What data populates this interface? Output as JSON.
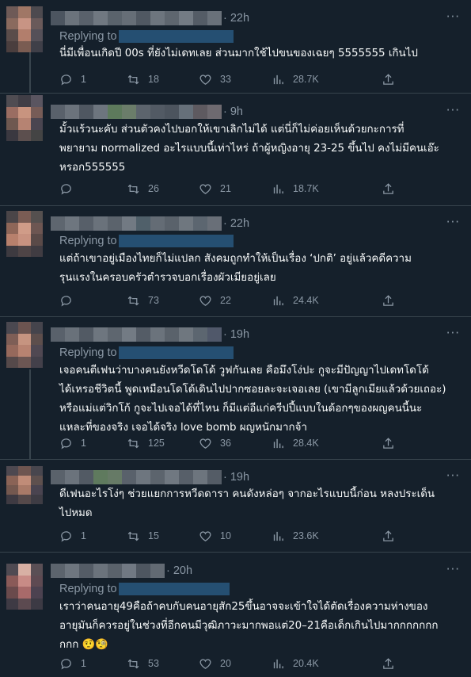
{
  "tweets": [
    {
      "time": "22h",
      "replying_to": "Replying to",
      "text": "นี่มีเพื่อนเกิดปี 00s ที่ยังไม่เดทเลย ส่วนมากใช้ไปขนของเฉยๆ 5555555 เกินไป",
      "replies": "1",
      "retweets": "18",
      "likes": "33",
      "views": "28.7K"
    },
    {
      "time": "9h",
      "replying_to": "",
      "text": "มั้วแร้วนะคับ ส่วนตัวคงไปบอกให้เขาเลิกไม่ได้ แต่นี่ก็ไม่ค่อยเห็นด้วยกะการที่\nพยายาม normalized อะไรแบบนี้เท่าไหร่ ถ้าผู้หญิงอายุ 23-25 ขึ้นไป คงไม่มีคนเอ๊ะ\nหรอก555555",
      "replies": "",
      "retweets": "26",
      "likes": "21",
      "views": "18.7K"
    },
    {
      "time": "22h",
      "replying_to": "Replying to",
      "text": "แต่ถ้าเขาอยู่เมืองไทยก็ไม่แปลก สังคมถูกทำให้เป็นเรื่อง ‘ปกติ’ อยู่แล้วคดีความ\nรุนแรงในครอบครัวตำรวจบอกเรื่องผัวเมียอยู่เลย",
      "replies": "",
      "retweets": "73",
      "likes": "22",
      "views": "24.4K"
    },
    {
      "time": "19h",
      "replying_to": "Replying to",
      "text": "เจอคนตีเฟนว่าบางคนยังหวีดโดโด้ วูฟกันเลย คือมึงโง่ปะ กูจะมีปัญญาไปเดทโดโด้\nได้เหรอชีวิตนี้ พูดเหมือนโดโด้เดินไปปากซอยละจะเจอเลย (เขามีลูกเมียแล้วด้วยเถอะ)\nหรือแม่แต่วิกโก้ กูจะไปเจอได้ที่ไหน ก็มีแต่อีแก่ครีปปี้แบบในด้อกๆของผญคนนี้นะ\nแหละที่ของจริง เจอได้จริง love bomb ผญหนักมากจ้า",
      "replies": "1",
      "retweets": "125",
      "likes": "36",
      "views": "28.4K"
    },
    {
      "time": "19h",
      "replying_to": "",
      "text": "ดีเฟนอะไรโง่ๆ ช่วยแยกการหวีดดารา คนดังหล่อๆ จากอะไรแบบนี้ก่อน หลงประเด็น\nไปหมด",
      "replies": "1",
      "retweets": "15",
      "likes": "10",
      "views": "23.6K"
    },
    {
      "time": "20h",
      "replying_to": "Replying to",
      "text": "เราว่าคนอายุ49คือถ้าคบกับคนอายุสัก25ขึ้นอาจจะเข้าใจได้ตัดเรื่องความห่างของ\nอายุมันก็ควรอยู่ในช่วงที่อีกคนมีวุฒิภาวะมากพอแต่20–21คือเด็กเกินไปมากกกกกกก\nกกก 🤨🧐",
      "replies": "1",
      "retweets": "53",
      "likes": "20",
      "views": "20.4K"
    }
  ],
  "icons": {
    "reply": "reply-icon",
    "retweet": "retweet-icon",
    "like": "heart-icon",
    "views": "views-icon",
    "share": "share-icon",
    "more": "more-icon"
  },
  "more_label": "···"
}
